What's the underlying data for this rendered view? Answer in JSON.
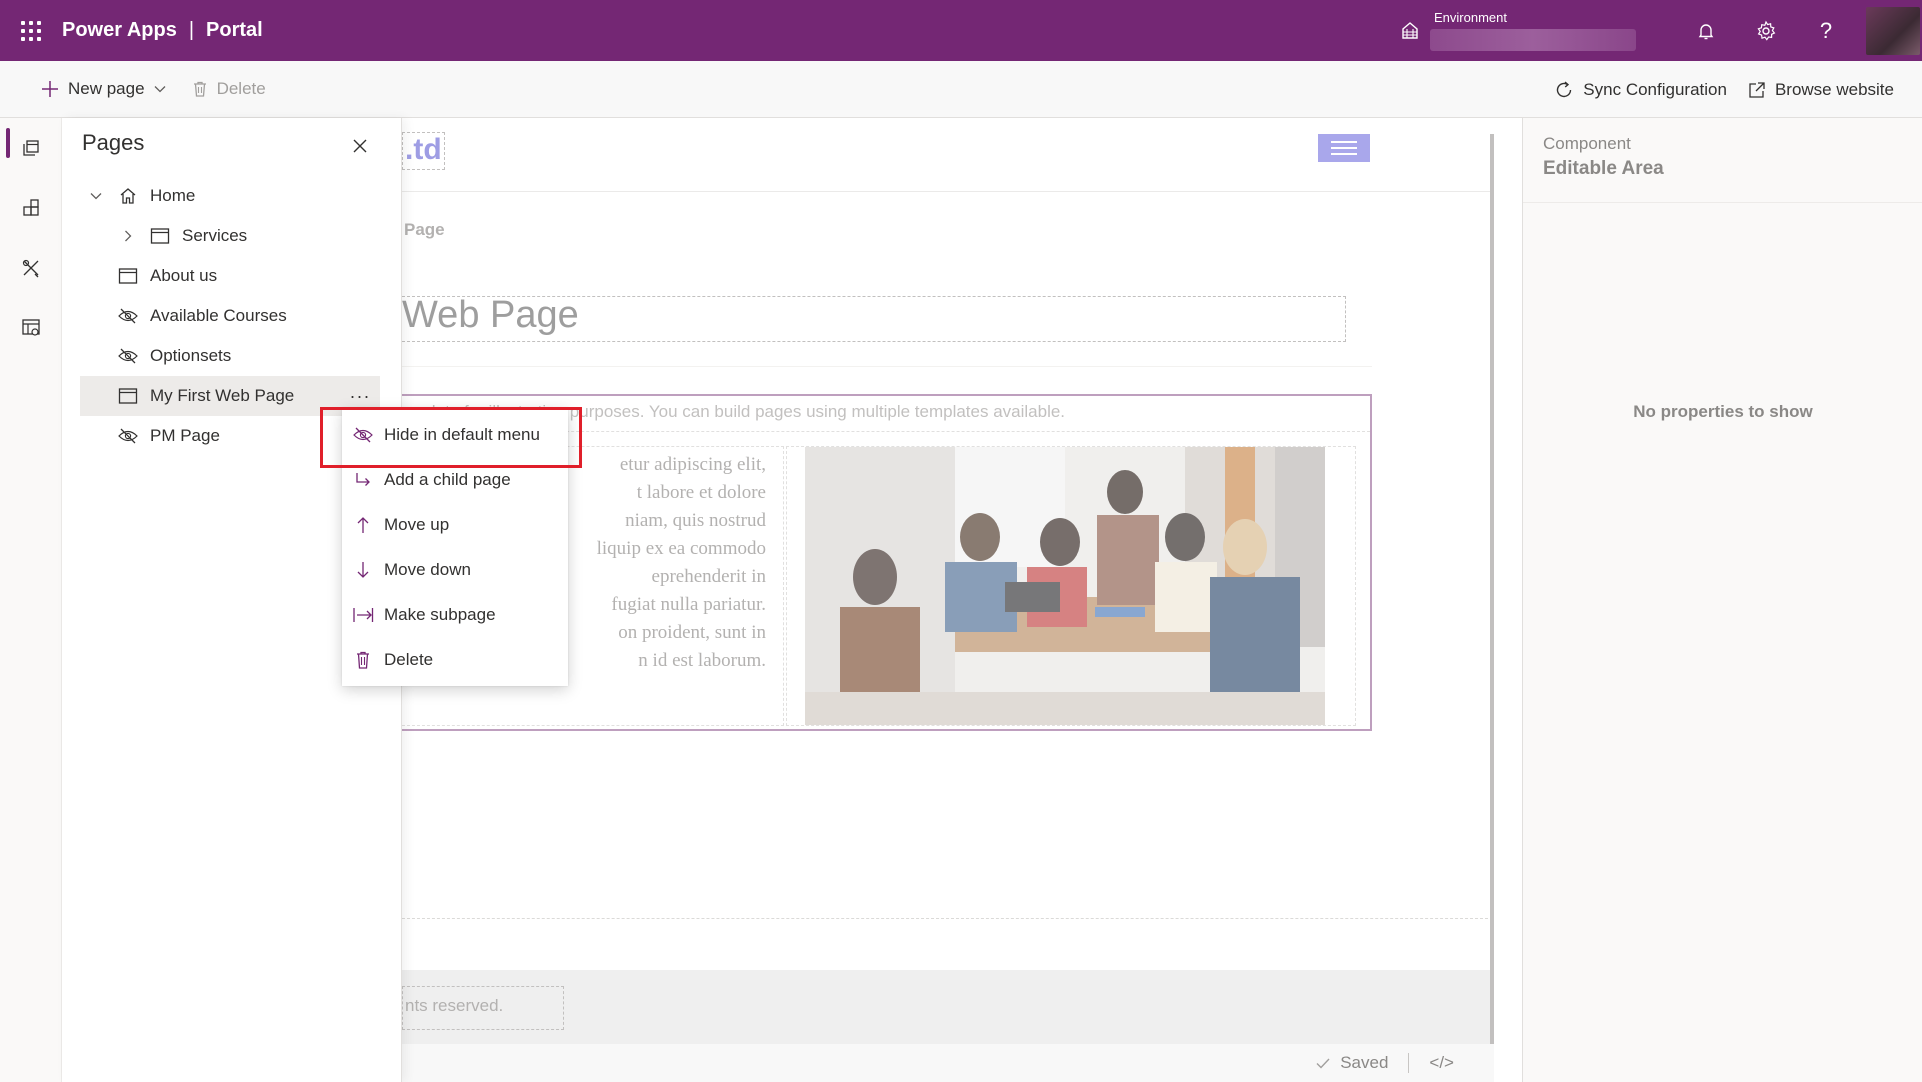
{
  "header": {
    "app_name": "Power Apps",
    "separator": "|",
    "area": "Portal",
    "environment_label": "Environment",
    "icons": [
      "waffle-icon",
      "environment-icon",
      "bell-icon",
      "gear-icon",
      "help-icon"
    ],
    "help_glyph": "?"
  },
  "commandbar": {
    "new_page": "New page",
    "delete": "Delete",
    "sync": "Sync Configuration",
    "browse": "Browse website"
  },
  "pages_panel": {
    "title": "Pages",
    "items": [
      {
        "label": "Home",
        "icon": "home-icon",
        "expanded": true
      },
      {
        "label": "Services",
        "icon": "page-icon",
        "expandable": true
      },
      {
        "label": "About us",
        "icon": "page-icon"
      },
      {
        "label": "Available Courses",
        "icon": "hidden-icon"
      },
      {
        "label": "Optionsets",
        "icon": "hidden-icon"
      },
      {
        "label": "My First Web Page",
        "icon": "page-icon",
        "selected": true,
        "more": "···"
      },
      {
        "label": "PM Page",
        "icon": "hidden-icon"
      }
    ]
  },
  "context_menu": {
    "items": [
      {
        "label": "Hide in default menu",
        "icon": "hidden-icon",
        "highlighted": true
      },
      {
        "label": "Add a child page",
        "icon": "child-arrow-icon"
      },
      {
        "label": "Move up",
        "icon": "arrow-up-icon"
      },
      {
        "label": "Move down",
        "icon": "arrow-down-icon"
      },
      {
        "label": "Make subpage",
        "icon": "indent-icon"
      },
      {
        "label": "Delete",
        "icon": "trash-icon"
      }
    ],
    "highlight_color": "#e01f2a"
  },
  "canvas": {
    "logo_fragment": ".td",
    "breadcrumb": "Page",
    "page_title": "Web Page",
    "description": "e data for illustration purposes. You can build pages using multiple templates available.",
    "lorem_lines": [
      "etur adipiscing elit,",
      "t labore et dolore",
      "niam, quis nostrud",
      "liquip ex ea commodo",
      "eprehenderit in",
      "fugiat nulla pariatur.",
      "on proident, sunt in",
      "n id est laborum."
    ],
    "footer_text": "nts reserved."
  },
  "status": {
    "saved": "Saved",
    "code_glyph": "</>"
  },
  "right_panel": {
    "component_label": "Component",
    "component_value": "Editable Area",
    "empty_message": "No properties to show"
  },
  "colors": {
    "brand": "#742774",
    "accent_button": "#7b78e0",
    "logo_text": "#6b69d6"
  }
}
